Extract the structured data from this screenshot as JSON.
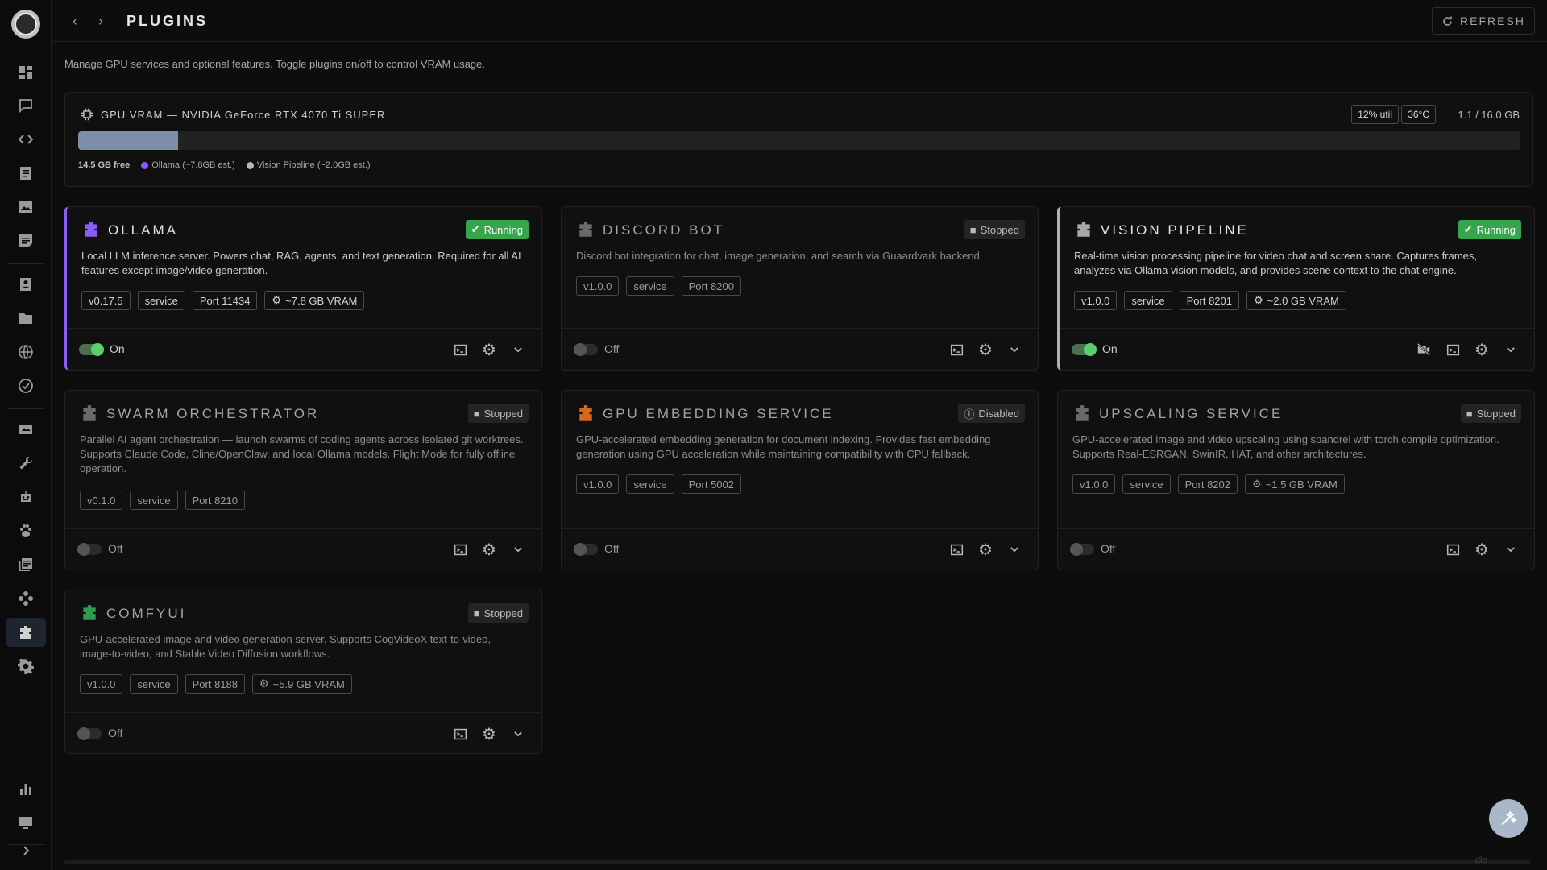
{
  "header": {
    "title": "PLUGINS",
    "refresh_label": "REFRESH"
  },
  "description": "Manage GPU services and optional features. Toggle plugins on/off to control VRAM usage.",
  "gpu": {
    "title": "GPU VRAM — NVIDIA GeForce RTX 4070 Ti SUPER",
    "util": "12% util",
    "temp": "36°C",
    "usage": "1.1 / 16.0 GB",
    "used_fraction": 0.069,
    "free": "14.5 GB free",
    "legend_ollama": "Ollama (~7.8GB est.)",
    "legend_vision": "Vision Pipeline (~2.0GB est.)",
    "bar_color": "#7d8ea8",
    "ollama_color": "#8b5cf6",
    "vision_color": "#b8b8b8"
  },
  "plugins": {
    "ollama": {
      "title": "OLLAMA",
      "status": "Running",
      "description": "Local LLM inference server. Powers chat, RAG, agents, and text generation. Required for all AI features except image/video generation.",
      "version": "v0.17.5",
      "type": "service",
      "port": "Port 11434",
      "vram": "~7.8 GB VRAM",
      "toggle": "On",
      "icon_color": "#8b5cf6"
    },
    "discord": {
      "title": "DISCORD BOT",
      "status": "Stopped",
      "description": "Discord bot integration for chat, image generation, and search via Guaardvark backend",
      "version": "v1.0.0",
      "type": "service",
      "port": "Port 8200",
      "toggle": "Off",
      "icon_color": "#6a6a6a"
    },
    "vision": {
      "title": "VISION PIPELINE",
      "status": "Running",
      "description": "Real-time vision processing pipeline for video chat and screen share. Captures frames, analyzes via Ollama vision models, and provides scene context to the chat engine.",
      "version": "v1.0.0",
      "type": "service",
      "port": "Port 8201",
      "vram": "~2.0 GB VRAM",
      "toggle": "On",
      "icon_color": "#a8a8a8"
    },
    "swarm": {
      "title": "SWARM ORCHESTRATOR",
      "status": "Stopped",
      "description": "Parallel AI agent orchestration — launch swarms of coding agents across isolated git worktrees. Supports Claude Code, Cline/OpenClaw, and local Ollama models. Flight Mode for fully offline operation.",
      "version": "v0.1.0",
      "type": "service",
      "port": "Port 8210",
      "toggle": "Off",
      "icon_color": "#6a6a6a"
    },
    "embedding": {
      "title": "GPU EMBEDDING SERVICE",
      "status": "Disabled",
      "description": "GPU-accelerated embedding generation for document indexing. Provides fast embedding generation using GPU acceleration while maintaining compatibility with CPU fallback.",
      "version": "v1.0.0",
      "type": "service",
      "port": "Port 5002",
      "toggle": "Off",
      "icon_color": "#d9661e"
    },
    "upscaling": {
      "title": "UPSCALING SERVICE",
      "status": "Stopped",
      "description": "GPU-accelerated image and video upscaling using spandrel with torch.compile optimization. Supports Real-ESRGAN, SwinIR, HAT, and other architectures.",
      "version": "v1.0.0",
      "type": "service",
      "port": "Port 8202",
      "vram": "~1.5 GB VRAM",
      "toggle": "Off",
      "icon_color": "#6a6a6a"
    },
    "comfyui": {
      "title": "COMFYUI",
      "status": "Stopped",
      "description": "GPU-accelerated image and video generation server. Supports CogVideoX text-to-video, image-to-video, and Stable Video Diffusion workflows.",
      "version": "v1.0.0",
      "type": "service",
      "port": "Port 8188",
      "vram": "~5.9 GB VRAM",
      "toggle": "Off",
      "icon_color": "#2e9c4a"
    }
  },
  "footer": {
    "idle": "Idle"
  }
}
